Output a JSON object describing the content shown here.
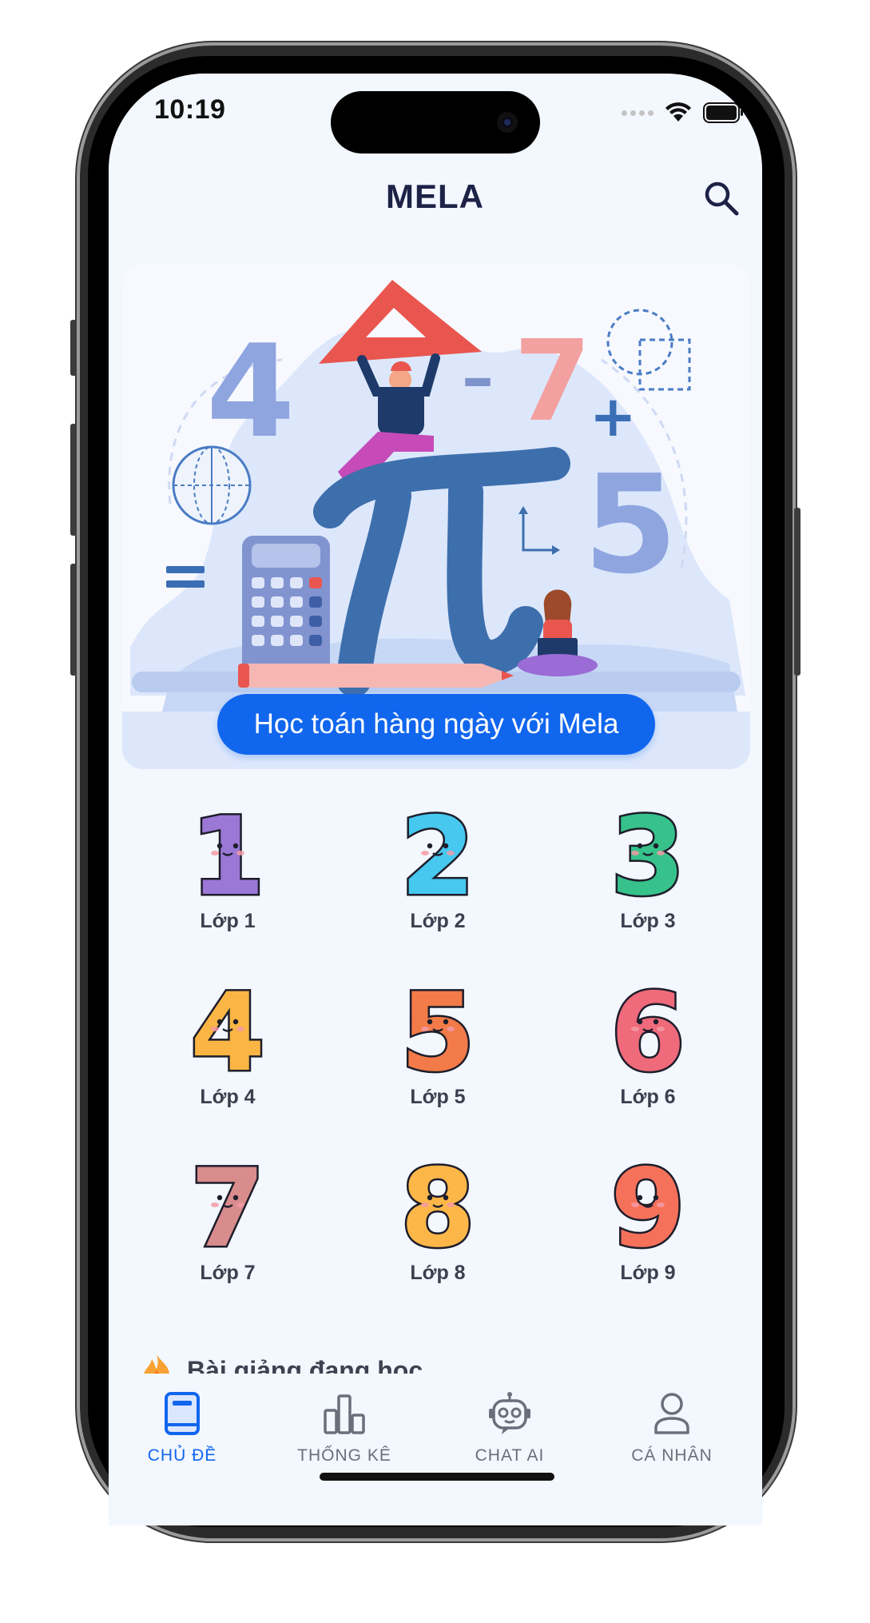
{
  "status_bar": {
    "time": "10:19"
  },
  "header": {
    "title": "MELA"
  },
  "hero": {
    "cta_label": "Học toán hàng ngày với Mela"
  },
  "grades": [
    {
      "label": "Lớp 1",
      "color": "#9b78d6"
    },
    {
      "label": "Lớp 2",
      "color": "#46c8ef"
    },
    {
      "label": "Lớp 3",
      "color": "#36c28a"
    },
    {
      "label": "Lớp 4",
      "color": "#fbb544"
    },
    {
      "label": "Lớp 5",
      "color": "#f27b49"
    },
    {
      "label": "Lớp 6",
      "color": "#ef6a7a"
    },
    {
      "label": "Lớp 7",
      "color": "#d98c8c"
    },
    {
      "label": "Lớp 8",
      "color": "#fdb748"
    },
    {
      "label": "Lớp 9",
      "color": "#f5715a"
    }
  ],
  "section": {
    "title": "Bài giảng đang học"
  },
  "nav": {
    "items": [
      {
        "label": "CHỦ ĐỀ",
        "icon": "book-icon",
        "active": true
      },
      {
        "label": "THỐNG KÊ",
        "icon": "bar-chart-icon",
        "active": false
      },
      {
        "label": "CHAT AI",
        "icon": "robot-icon",
        "active": false
      },
      {
        "label": "CÁ NHÂN",
        "icon": "user-icon",
        "active": false
      }
    ]
  },
  "colors": {
    "accent": "#1166ee",
    "title": "#1d2247",
    "background": "#f3f7fe"
  }
}
